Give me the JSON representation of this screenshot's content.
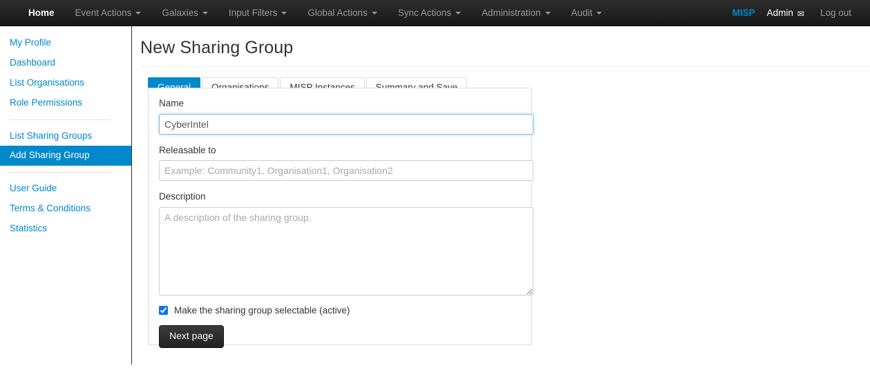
{
  "navbar": {
    "left_items": [
      {
        "label": "Home",
        "has_caret": false,
        "active": true
      },
      {
        "label": "Event Actions",
        "has_caret": true,
        "active": false
      },
      {
        "label": "Galaxies",
        "has_caret": true,
        "active": false
      },
      {
        "label": "Input Filters",
        "has_caret": true,
        "active": false
      },
      {
        "label": "Global Actions",
        "has_caret": true,
        "active": false
      },
      {
        "label": "Sync Actions",
        "has_caret": true,
        "active": false
      },
      {
        "label": "Administration",
        "has_caret": true,
        "active": false
      },
      {
        "label": "Audit",
        "has_caret": true,
        "active": false
      }
    ],
    "brand": "MISP",
    "user": "Admin",
    "mail_icon": "envelope-icon",
    "mail_glyph": "✉",
    "logout": "Log out",
    "brand_color": "#0088cc"
  },
  "sidebar": {
    "groups": [
      {
        "items": [
          {
            "label": "My Profile",
            "active": false
          },
          {
            "label": "Dashboard",
            "active": false
          },
          {
            "label": "List Organisations",
            "active": false
          },
          {
            "label": "Role Permissions",
            "active": false
          }
        ]
      },
      {
        "items": [
          {
            "label": "List Sharing Groups",
            "active": false
          },
          {
            "label": "Add Sharing Group",
            "active": true
          }
        ]
      },
      {
        "items": [
          {
            "label": "User Guide",
            "active": false
          },
          {
            "label": "Terms & Conditions",
            "active": false
          },
          {
            "label": "Statistics",
            "active": false
          }
        ]
      }
    ],
    "active_bg": "#0088cc",
    "link_color": "#0088cc"
  },
  "main": {
    "page_title": "New Sharing Group",
    "tabs": [
      {
        "label": "General",
        "active": true
      },
      {
        "label": "Organisations",
        "active": false
      },
      {
        "label": "MISP Instances",
        "active": false
      },
      {
        "label": "Summary and Save",
        "active": false
      }
    ],
    "form": {
      "name_label": "Name",
      "name_value": "CyberIntel",
      "name_placeholder": "",
      "releasable_label": "Releasable to",
      "releasable_value": "",
      "releasable_placeholder": "Example: Community1, Organisation1, Organisation2",
      "description_label": "Description",
      "description_value": "",
      "description_placeholder": "A description of the sharing group.",
      "selectable_label": "Make the sharing group selectable (active)",
      "selectable_checked": true,
      "next_button": "Next page"
    }
  }
}
